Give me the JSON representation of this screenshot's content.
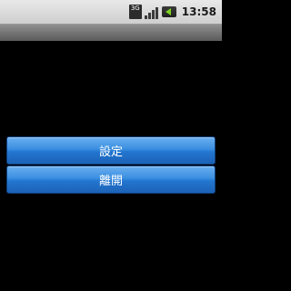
{
  "status_bar": {
    "network_label": "3G",
    "network_icon": "3g-network-icon",
    "signal_icon": "signal-strength-icon",
    "battery_icon": "charging-battery-icon",
    "time": "13:58"
  },
  "buttons": {
    "settings_label": "設定",
    "exit_label": "離開"
  },
  "colors": {
    "button_top": "#6aaff0",
    "button_bottom": "#1c62b6",
    "background": "#000000",
    "battery_accent": "#7ed321"
  }
}
